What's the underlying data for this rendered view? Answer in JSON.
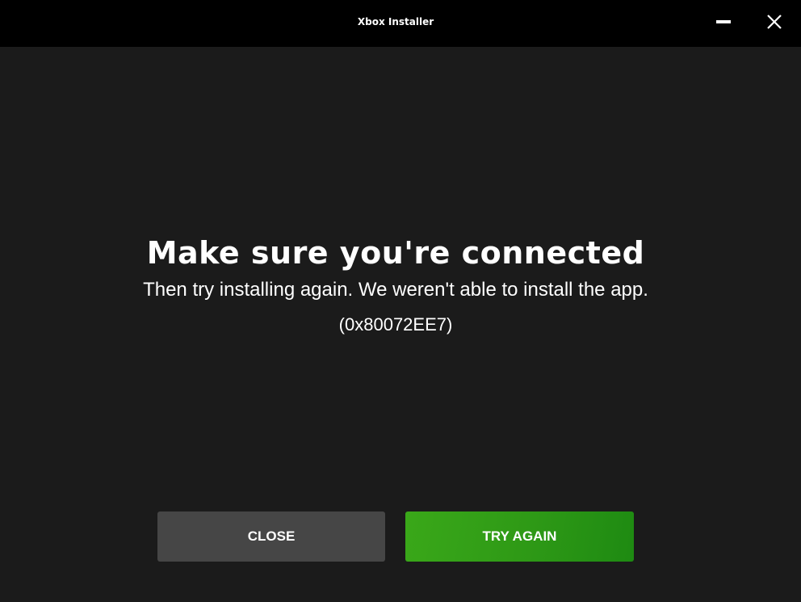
{
  "window": {
    "title": "Xbox Installer",
    "controls": {
      "minimize_icon": "minimize-icon",
      "close_icon": "close-icon"
    }
  },
  "message": {
    "heading": "Make sure you're connected",
    "body": "Then try installing again. We weren't able to install the app.",
    "error_code": "(0x80072EE7)"
  },
  "actions": {
    "close_label": "CLOSE",
    "try_again_label": "TRY AGAIN"
  },
  "colors": {
    "titlebar_bg": "#000000",
    "content_bg": "#1b1b1b",
    "secondary_button": "#464646",
    "primary_button": "#2e9916",
    "text": "#ffffff"
  }
}
